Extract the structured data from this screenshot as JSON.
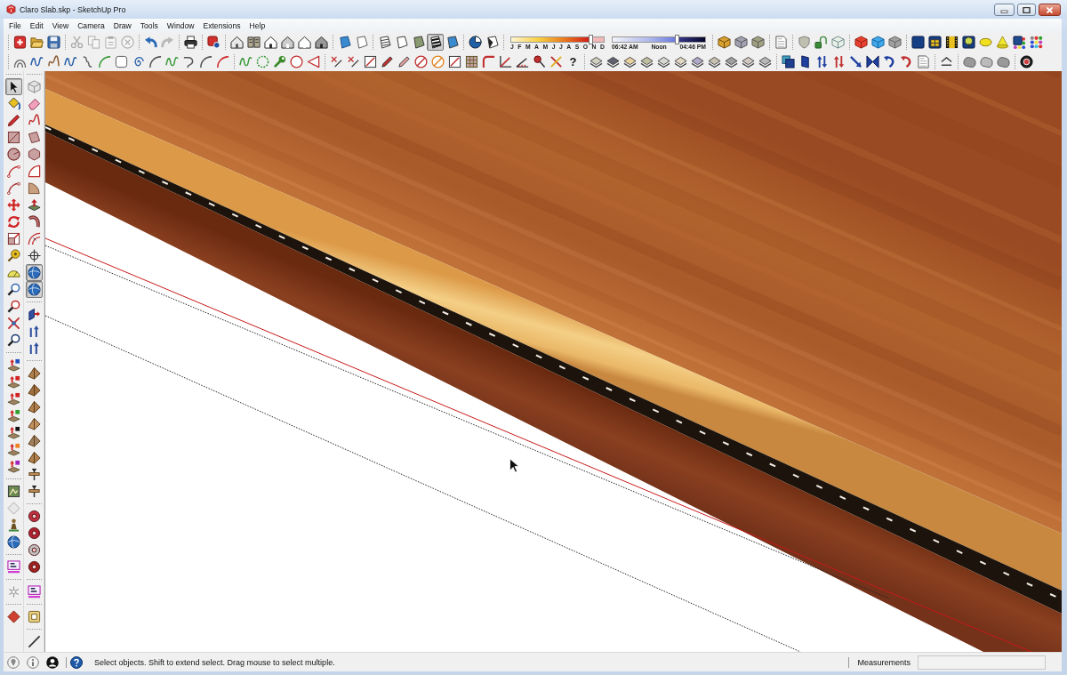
{
  "window": {
    "title": "Claro Slab.skp - SketchUp Pro"
  },
  "menu": [
    "File",
    "Edit",
    "View",
    "Camera",
    "Draw",
    "Tools",
    "Window",
    "Extensions",
    "Help"
  ],
  "toolbar_rows": [
    {
      "groups": [
        {
          "kind": "buttons",
          "buttons": [
            {
              "selected": false
            },
            {
              "selected": false
            },
            {
              "selected": false
            }
          ]
        },
        {
          "kind": "buttons",
          "buttons": [
            {
              "selected": false,
              "disabled": true
            },
            {
              "selected": false,
              "disabled": true
            },
            {
              "selected": false,
              "disabled": true
            },
            {
              "selected": false,
              "disabled": true
            }
          ]
        },
        {
          "kind": "buttons",
          "buttons": [
            {
              "selected": false,
              "disabled": false
            },
            {
              "selected": false,
              "disabled": true
            }
          ]
        },
        {
          "kind": "buttons",
          "buttons": [
            {
              "selected": false
            }
          ]
        },
        {
          "kind": "buttons",
          "buttons": [
            {
              "selected": false
            }
          ]
        },
        {
          "kind": "buttons",
          "buttons": [
            {
              "selected": false
            },
            {
              "selected": false
            },
            {
              "selected": false
            },
            {
              "selected": false
            },
            {
              "selected": false
            },
            {
              "selected": false
            }
          ]
        },
        {
          "kind": "buttons",
          "buttons": [
            {
              "selected": false
            },
            {
              "selected": false
            }
          ]
        },
        {
          "kind": "buttons",
          "buttons": [
            {
              "selected": false
            },
            {
              "selected": false
            },
            {
              "selected": false
            },
            {
              "selected": true
            },
            {
              "selected": false
            }
          ]
        },
        {
          "kind": "buttons",
          "buttons": [
            {
              "selected": false
            },
            {
              "selected": false
            }
          ]
        },
        {
          "kind": "month_slider",
          "level": 0.86,
          "labels": [
            "J",
            "F",
            "M",
            "A",
            "M",
            "J",
            "J",
            "A",
            "S",
            "O",
            "N",
            "D"
          ]
        },
        {
          "kind": "time_slider",
          "level": 0.69,
          "labels": [
            "06:42 AM",
            "Noon",
            "04:46 PM"
          ]
        },
        {
          "kind": "buttons",
          "buttons": [
            {
              "selected": false
            },
            {
              "selected": false
            },
            {
              "selected": false
            }
          ]
        },
        {
          "kind": "buttons",
          "buttons": [
            {
              "selected": false
            }
          ]
        },
        {
          "kind": "buttons",
          "buttons": [
            {
              "selected": false
            },
            {
              "selected": false
            },
            {
              "selected": false
            }
          ]
        },
        {
          "kind": "buttons",
          "buttons": [
            {
              "selected": false
            },
            {
              "selected": false
            },
            {
              "selected": false
            }
          ]
        },
        {
          "kind": "buttons",
          "buttons": [
            {
              "selected": false
            },
            {
              "selected": false
            },
            {
              "selected": false
            },
            {
              "selected": false
            },
            {
              "selected": false
            },
            {
              "selected": false
            },
            {
              "selected": false
            },
            {
              "selected": false
            }
          ]
        }
      ]
    },
    {
      "groups": [
        {
          "kind": "buttons",
          "buttons": [
            {
              "selected": false
            },
            {
              "selected": false
            },
            {
              "selected": false
            },
            {
              "selected": false
            },
            {
              "selected": false
            },
            {
              "selected": false
            },
            {
              "selected": false
            },
            {
              "selected": false
            },
            {
              "selected": false
            },
            {
              "selected": false
            },
            {
              "selected": false
            },
            {
              "selected": false
            },
            {
              "selected": false
            }
          ]
        },
        {
          "kind": "buttons",
          "buttons": [
            {
              "selected": false
            },
            {
              "selected": false
            },
            {
              "selected": false
            },
            {
              "selected": false
            },
            {
              "selected": false
            }
          ]
        },
        {
          "kind": "buttons",
          "buttons": [
            {
              "selected": false
            },
            {
              "selected": false
            },
            {
              "selected": false
            },
            {
              "selected": false
            },
            {
              "selected": false
            },
            {
              "selected": false
            },
            {
              "selected": false
            },
            {
              "selected": false
            },
            {
              "selected": false
            },
            {
              "selected": false
            },
            {
              "selected": false
            },
            {
              "selected": false
            },
            {
              "selected": false
            },
            {
              "selected": false
            },
            {
              "selected": false,
              "glyph": "?"
            }
          ]
        },
        {
          "kind": "buttons",
          "buttons": [
            {
              "selected": false
            },
            {
              "selected": false
            },
            {
              "selected": false
            },
            {
              "selected": false
            },
            {
              "selected": false
            },
            {
              "selected": false
            },
            {
              "selected": false
            },
            {
              "selected": false
            },
            {
              "selected": false
            },
            {
              "selected": false
            },
            {
              "selected": false
            }
          ]
        },
        {
          "kind": "buttons",
          "buttons": [
            {
              "selected": false
            },
            {
              "selected": false
            },
            {
              "selected": false
            },
            {
              "selected": false
            },
            {
              "selected": false
            },
            {
              "selected": false
            },
            {
              "selected": false
            },
            {
              "selected": false
            },
            {
              "selected": false
            }
          ]
        },
        {
          "kind": "buttons",
          "buttons": [
            {
              "selected": false
            }
          ]
        },
        {
          "kind": "buttons",
          "buttons": [
            {
              "selected": false
            },
            {
              "selected": false
            },
            {
              "selected": false
            }
          ]
        },
        {
          "kind": "buttons",
          "buttons": [
            {
              "selected": false
            }
          ]
        }
      ]
    }
  ],
  "side_toolbars": [
    {
      "groups": [
        {
          "buttons": [
            {
              "selected": true
            },
            {
              "selected": false
            },
            {
              "selected": false
            },
            {
              "selected": false
            },
            {
              "selected": false
            },
            {
              "selected": false
            },
            {
              "selected": false
            },
            {
              "selected": false
            },
            {
              "selected": false
            },
            {
              "selected": false
            },
            {
              "selected": false
            },
            {
              "selected": false
            },
            {
              "selected": false
            },
            {
              "selected": false
            },
            {
              "selected": false
            },
            {
              "selected": false
            }
          ]
        },
        {
          "buttons": [
            {
              "selected": false
            },
            {
              "selected": false
            },
            {
              "selected": false
            },
            {
              "selected": false
            },
            {
              "selected": false
            },
            {
              "selected": false
            },
            {
              "selected": false
            }
          ]
        },
        {
          "buttons": [
            {
              "selected": false
            },
            {
              "selected": false
            },
            {
              "selected": false
            },
            {
              "selected": false
            }
          ]
        },
        {
          "buttons": [
            {
              "selected": false
            }
          ]
        },
        {
          "buttons": [
            {
              "selected": false
            }
          ]
        },
        {
          "buttons": [
            {
              "selected": false
            }
          ]
        }
      ]
    },
    {
      "groups": [
        {
          "buttons": [
            {
              "selected": false
            },
            {
              "selected": false
            },
            {
              "selected": false
            },
            {
              "selected": false
            },
            {
              "selected": false
            },
            {
              "selected": false
            },
            {
              "selected": false
            },
            {
              "selected": false
            },
            {
              "selected": false
            },
            {
              "selected": false
            },
            {
              "selected": false
            },
            {
              "selected": true
            },
            {
              "selected": true
            }
          ]
        },
        {
          "buttons": [
            {
              "selected": false
            },
            {
              "selected": false
            },
            {
              "selected": false
            }
          ]
        },
        {
          "buttons": [
            {
              "selected": false
            },
            {
              "selected": false
            },
            {
              "selected": false
            },
            {
              "selected": false
            },
            {
              "selected": false
            },
            {
              "selected": false
            },
            {
              "selected": false
            },
            {
              "selected": false
            }
          ]
        },
        {
          "buttons": [
            {
              "selected": false
            },
            {
              "selected": false
            },
            {
              "selected": false
            },
            {
              "selected": false
            }
          ]
        },
        {
          "buttons": [
            {
              "selected": false
            }
          ]
        },
        {
          "buttons": [
            {
              "selected": false
            }
          ]
        },
        {
          "buttons": [
            {
              "selected": false
            }
          ]
        }
      ]
    }
  ],
  "status_bar": {
    "message": "Select objects. Shift to extend select. Drag mouse to select multiple.",
    "measurements_label": "Measurements"
  }
}
